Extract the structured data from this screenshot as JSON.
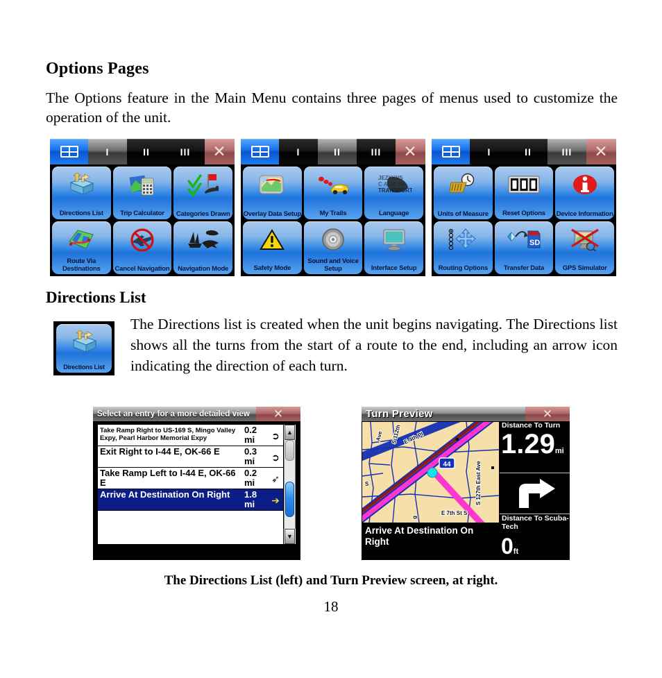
{
  "document": {
    "section_title": "Options Pages",
    "intro_paragraph": "The Options feature in the Main Menu contains three pages of menus used to customize the operation of the unit.",
    "subsection_title": "Directions List",
    "subsection_paragraph": "The Directions list is created when the unit begins navigating. The Directions list shows all the turns from the start of a route to the end, including an arrow icon indicating the direction of each turn.",
    "figure_caption": "The Directions List (left) and Turn Preview screen, at right.",
    "page_number": "18"
  },
  "colors": {
    "tile_blue": "#2f86e6",
    "tab_active_blue": "#1572ef",
    "close_red": "#b06a6a",
    "selection_navy": "#0b1d86",
    "map_land": "#f6dfa8",
    "route_magenta": "#ff35d0",
    "highway_maroon": "#8b1a1a",
    "gps_cursor_cyan": "#16e0f0"
  },
  "options_panels": [
    {
      "panel_name": "options-page-1",
      "tabs": {
        "home_icon": "grid-icon",
        "items": [
          "I",
          "II",
          "III"
        ],
        "active": "I",
        "close_icon": "close-icon"
      },
      "tiles": [
        {
          "label": "Directions List",
          "icon": "directions-list-icon"
        },
        {
          "label": "Trip Calculator",
          "icon": "trip-calculator-icon"
        },
        {
          "label": "Categories Drawn",
          "icon": "categories-drawn-icon"
        },
        {
          "label": "Route Via Destinations",
          "icon": "route-via-destinations-icon"
        },
        {
          "label": "Cancel Navigation",
          "icon": "cancel-navigation-icon"
        },
        {
          "label": "Navigation Mode",
          "icon": "navigation-mode-icon"
        }
      ]
    },
    {
      "panel_name": "options-page-2",
      "tabs": {
        "home_icon": "grid-icon",
        "items": [
          "I",
          "II",
          "III"
        ],
        "active": "II",
        "close_icon": "close-icon"
      },
      "tiles": [
        {
          "label": "Overlay Data Setup",
          "icon": "overlay-data-setup-icon"
        },
        {
          "label": "My Trails",
          "icon": "my-trails-icon"
        },
        {
          "label": "Language",
          "icon": "language-icon"
        },
        {
          "label": "Safety Mode",
          "icon": "safety-mode-icon"
        },
        {
          "label": "Sound and Voice Setup",
          "icon": "sound-and-voice-setup-icon"
        },
        {
          "label": "Interface Setup",
          "icon": "interface-setup-icon"
        }
      ]
    },
    {
      "panel_name": "options-page-3",
      "tabs": {
        "home_icon": "grid-icon",
        "items": [
          "I",
          "II",
          "III"
        ],
        "active": "III",
        "close_icon": "close-icon"
      },
      "tiles": [
        {
          "label": "Units of Measure",
          "icon": "units-of-measure-icon"
        },
        {
          "label": "Reset Options",
          "icon": "reset-options-icon"
        },
        {
          "label": "Device Information",
          "icon": "device-information-icon"
        },
        {
          "label": "Routing Options",
          "icon": "routing-options-icon"
        },
        {
          "label": "Transfer Data",
          "icon": "transfer-data-icon"
        },
        {
          "label": "GPS Simulator",
          "icon": "gps-simulator-icon"
        }
      ]
    }
  ],
  "inline_icon": {
    "label": "Directions List",
    "icon": "directions-list-icon"
  },
  "directions_list_screen": {
    "title": "Select an entry for a more detailed view",
    "close_icon": "close-icon",
    "rows": [
      {
        "text": "Take Ramp Right to US-169 S, Mingo Valley Expy, Pearl Harbor Memorial Expy",
        "distance": "0.2 mi",
        "arrow": "turn-slight-arrow-icon",
        "selected": false,
        "small": true
      },
      {
        "text": "Exit Right to I-44 E, OK-66 E",
        "distance": "0.3 mi",
        "arrow": "turn-slight-arrow-icon",
        "selected": false,
        "small": false
      },
      {
        "text": "Take Ramp Left to I-44 E, OK-66 E",
        "distance": "0.2 mi",
        "arrow": "turn-slight-left-arrow-icon",
        "selected": false,
        "small": false
      },
      {
        "text": "Arrive At Destination On Right",
        "distance": "1.8 mi",
        "arrow": "arrive-right-arrow-icon",
        "selected": true,
        "small": false
      }
    ],
    "scrollbar": {
      "up_icon": "scroll-up-icon",
      "down_icon": "scroll-down-icon"
    }
  },
  "turn_preview_screen": {
    "title": "Turn Preview",
    "close_icon": "close-icon",
    "banner_text": "Arrive At Destination On Right",
    "map_labels": [
      "S 112th",
      "Ave",
      "E 4th Pl",
      "S",
      "E 7th St S",
      "S 127th East Ave",
      "44"
    ],
    "panels": [
      {
        "label": "Distance To Turn",
        "value": "1.29",
        "unit": "mi"
      },
      {
        "label": "",
        "value": "",
        "unit": "",
        "icon": "turn-right-arrow-icon"
      },
      {
        "label": "Distance To Scuba-Tech",
        "value": "0",
        "unit": "ft"
      }
    ]
  }
}
